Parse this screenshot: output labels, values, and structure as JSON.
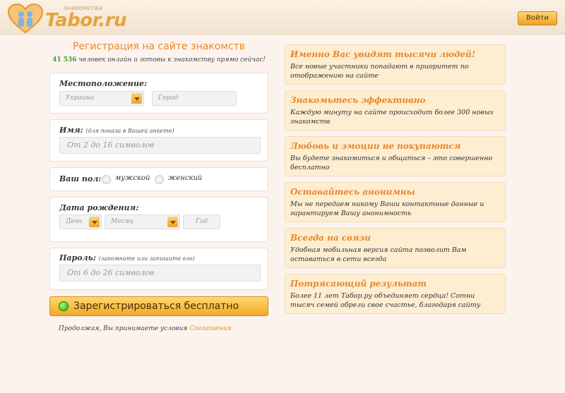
{
  "header": {
    "logo_small": "знакомства",
    "logo_text": "Tabor.ru",
    "login_label": "Войти",
    "brand_color": "#e8a23b"
  },
  "form": {
    "title": "Регистрация на сайте знакомств",
    "online_count": "41 536",
    "online_text": "человек онлайн и готовы к знакомству прямо сейчас!",
    "location": {
      "label": "Местоположение:",
      "country_value": "Украина",
      "city_placeholder": "Город"
    },
    "name": {
      "label": "Имя:",
      "hint": "(для показа в Вашей анкете)",
      "placeholder": "От 2 до 16 символов"
    },
    "gender": {
      "label": "Ваш пол:",
      "male": "мужской",
      "female": "женский"
    },
    "birth": {
      "label": "Дата рождения:",
      "day": "День",
      "month": "Месяц",
      "year": "Год"
    },
    "password": {
      "label": "Пароль:",
      "hint": "(запомните или запишите его)",
      "placeholder": "От 6 до 26 символов"
    },
    "submit_label": "Зарегистрироваться бесплатно",
    "terms_text": "Продолжая, Вы принимаете условия",
    "terms_link": "Соглашения"
  },
  "benefits": [
    {
      "title": "Именно Вас увидят тысячи людей!",
      "text": "Все новые участники попадают в приоритет по отображению на сайте"
    },
    {
      "title": "Знакомьтесь эффективно",
      "text": "Каждую минуту на сайте происходит более 300 новых знакомств"
    },
    {
      "title": "Любовь и эмоции не покупаются",
      "text": "Вы будете знакомиться и общаться – это совершенно бесплатно"
    },
    {
      "title": "Оставайтесь анонимны",
      "text": "Мы не передаем никому Ваши контактные данные и гарантируем Вашу анонимность"
    },
    {
      "title": "Всегда на связи",
      "text": "Удобная мобильная версия сайта позволит Вам оставаться в сети всегда"
    },
    {
      "title": "Потрясающий результат",
      "text": "Более 11 лет Табор.ру объединяет сердца! Сотни тысяч семей обрели свое счастье, благодаря сайту"
    }
  ]
}
